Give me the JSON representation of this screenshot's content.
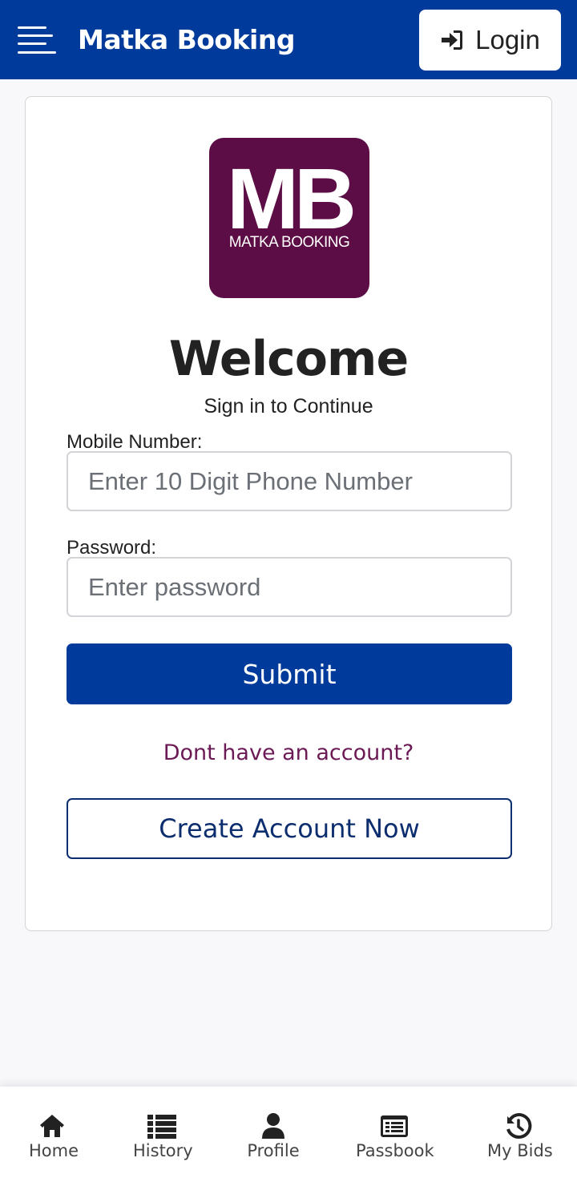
{
  "header": {
    "title": "Matka Booking",
    "login_label": "Login"
  },
  "logo": {
    "letters": "MB",
    "subtitle": "MATKA BOOKING"
  },
  "form": {
    "welcome": "Welcome",
    "subtitle": "Sign in to Continue",
    "mobile_label": "Mobile Number:",
    "mobile_placeholder": "Enter 10 Digit Phone Number",
    "password_label": "Password:",
    "password_placeholder": "Enter password",
    "submit_label": "Submit",
    "no_account_text": "Dont have an account?",
    "create_label": "Create Account Now"
  },
  "bottom_nav": {
    "items": [
      {
        "label": "Home",
        "icon": "home-icon"
      },
      {
        "label": "History",
        "icon": "list-icon"
      },
      {
        "label": "Profile",
        "icon": "user-icon"
      },
      {
        "label": "Passbook",
        "icon": "passbook-icon"
      },
      {
        "label": "My Bids",
        "icon": "history-clock-icon"
      }
    ]
  },
  "colors": {
    "brand": "#003a9b",
    "logo_bg": "#5c0d45",
    "link": "#6b1a55"
  }
}
